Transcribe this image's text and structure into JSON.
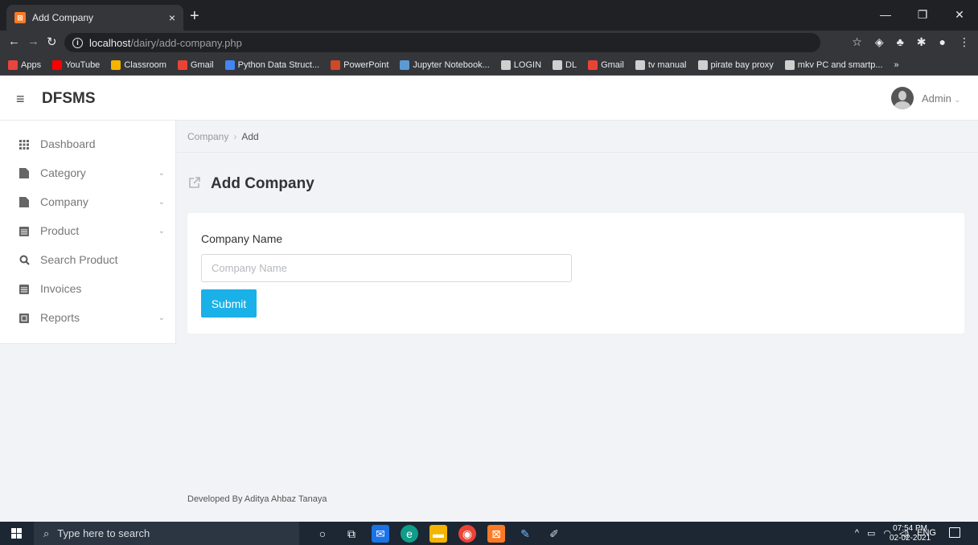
{
  "browser": {
    "tab_title": "Add Company",
    "tab_close": "×",
    "new_tab": "+",
    "url_host": "localhost",
    "url_path": "/dairy/add-company.php",
    "window_controls": [
      "—",
      "❐",
      "✕"
    ],
    "bookmarks": [
      {
        "label": "Apps",
        "color": "#e8453c"
      },
      {
        "label": "YouTube",
        "color": "#ff0000"
      },
      {
        "label": "Classroom",
        "color": "#f4b400"
      },
      {
        "label": "Gmail",
        "color": "#ea4335"
      },
      {
        "label": "Python Data Struct...",
        "color": "#4285f4"
      },
      {
        "label": "PowerPoint",
        "color": "#d24726"
      },
      {
        "label": "Jupyter Notebook...",
        "color": "#5b9bd5"
      },
      {
        "label": "LOGIN",
        "color": "#cfcfcf"
      },
      {
        "label": "DL",
        "color": "#cfcfcf"
      },
      {
        "label": "Gmail",
        "color": "#ea4335"
      },
      {
        "label": "tv manual",
        "color": "#cfcfcf"
      },
      {
        "label": "pirate bay proxy",
        "color": "#cfcfcf"
      },
      {
        "label": "mkv PC and smartp...",
        "color": "#cfcfcf"
      }
    ],
    "bookmarks_more": "»"
  },
  "header": {
    "brand": "DFSMS",
    "user": "Admin"
  },
  "sidebar": {
    "items": [
      {
        "label": "Dashboard",
        "icon": "grid-icon",
        "has_submenu": false
      },
      {
        "label": "Category",
        "icon": "file-icon",
        "has_submenu": true
      },
      {
        "label": "Company",
        "icon": "file-icon",
        "has_submenu": true
      },
      {
        "label": "Product",
        "icon": "list-icon",
        "has_submenu": true
      },
      {
        "label": "Search Product",
        "icon": "search-icon",
        "has_submenu": false
      },
      {
        "label": "Invoices",
        "icon": "list-icon",
        "has_submenu": false
      },
      {
        "label": "Reports",
        "icon": "report-icon",
        "has_submenu": true
      }
    ]
  },
  "breadcrumb": {
    "parent": "Company",
    "current": "Add"
  },
  "page": {
    "title": "Add Company"
  },
  "form": {
    "label": "Company Name",
    "placeholder": "Company Name",
    "value": "",
    "submit_label": "Submit"
  },
  "footer": {
    "text": "Developed By Aditya Ahbaz Tanaya"
  },
  "taskbar": {
    "search_placeholder": "Type here to search",
    "time": "07:54 PM",
    "date": "02-02-2021",
    "lang": "ENG"
  },
  "colors": {
    "accent": "#1ab0e8",
    "page_bg": "#f1f3f6"
  }
}
